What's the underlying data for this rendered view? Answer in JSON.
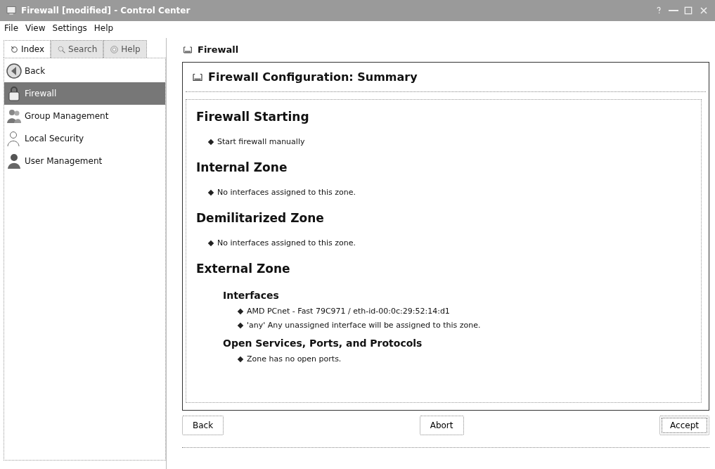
{
  "window": {
    "title": "Firewall [modified] - Control Center"
  },
  "menu": [
    "File",
    "View",
    "Settings",
    "Help"
  ],
  "tabs": [
    {
      "label": "Index",
      "selected": true
    },
    {
      "label": "Search",
      "selected": false
    },
    {
      "label": "Help",
      "selected": false
    }
  ],
  "sidebar": {
    "items": [
      {
        "label": "Back",
        "kind": "back",
        "selected": false
      },
      {
        "label": "Firewall",
        "kind": "lock",
        "selected": true
      },
      {
        "label": "Group Management",
        "kind": "group",
        "selected": false
      },
      {
        "label": "Local Security",
        "kind": "person",
        "selected": false
      },
      {
        "label": "User Management",
        "kind": "users",
        "selected": false
      }
    ]
  },
  "page_title": "Firewall",
  "panel_title": "Firewall Configuration: Summary",
  "sections": [
    {
      "title": "Firewall Starting",
      "items": [
        "Start firewall manually"
      ]
    },
    {
      "title": "Internal Zone",
      "items": [
        "No interfaces assigned to this zone."
      ]
    },
    {
      "title": "Demilitarized Zone",
      "items": [
        "No interfaces assigned to this zone."
      ]
    },
    {
      "title": "External Zone",
      "children": [
        {
          "title": "Interfaces",
          "items": [
            "AMD PCnet - Fast 79C971 / eth-id-00:0c:29:52:14:d1",
            "'any' Any unassigned interface will be assigned to this zone."
          ]
        },
        {
          "title": "Open Services, Ports, and Protocols",
          "items": [
            "Zone has no open ports."
          ]
        }
      ]
    }
  ],
  "buttons": [
    {
      "label": "Back",
      "kind": "back"
    },
    {
      "label": "Abort",
      "kind": "abort"
    },
    {
      "label": "Accept",
      "kind": "accept"
    }
  ]
}
